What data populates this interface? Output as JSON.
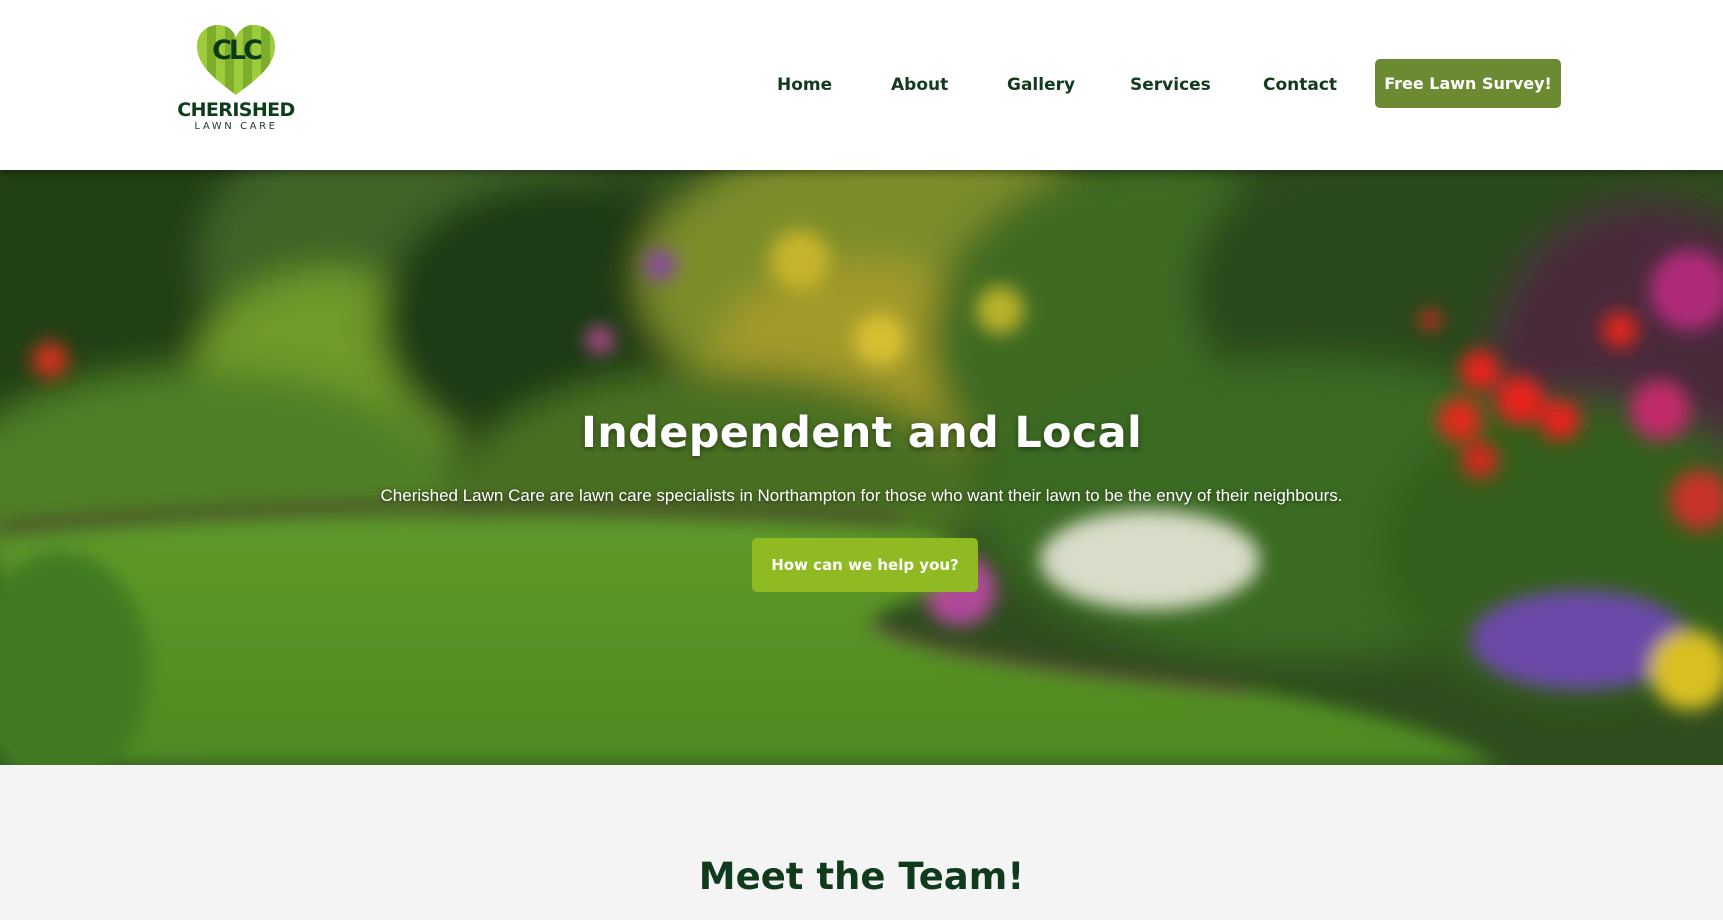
{
  "brand": {
    "monogram": "CLC",
    "name": "CHERISHED",
    "tagline": "LAWN CARE",
    "heart_icon": "heart-logo-icon",
    "colors": {
      "dark_green": "#0d3d1a",
      "heart_light": "#9ccc3a",
      "heart_dark": "#6ea125"
    }
  },
  "nav": {
    "items": [
      {
        "label": "Home"
      },
      {
        "label": "About"
      },
      {
        "label": "Gallery"
      },
      {
        "label": "Services"
      },
      {
        "label": "Contact"
      }
    ],
    "cta_label": "Free Lawn Survey!",
    "cta_color": "#6b8a32"
  },
  "hero": {
    "title": "Independent and Local",
    "text": "Cherished Lawn Care are lawn care specialists in Northampton for those who want their lawn to be the envy of their neighbours.",
    "cta_label": "How can we help you?",
    "cta_color": "#8fba22"
  },
  "team": {
    "title": "Meet the Team!"
  }
}
